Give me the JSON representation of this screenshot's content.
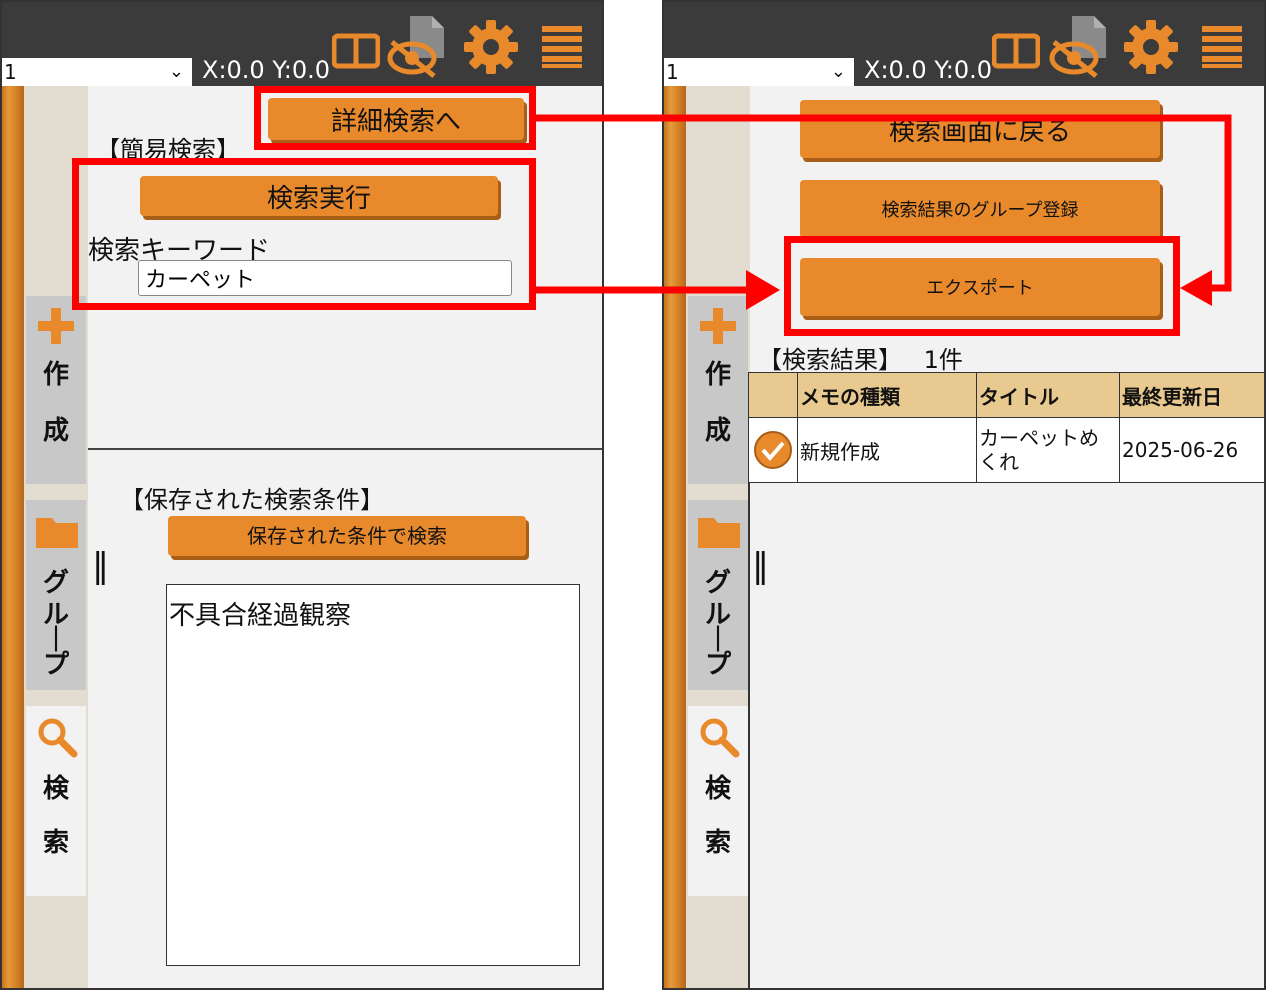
{
  "colors": {
    "accent": "#e8892c",
    "topbar": "#3b3b3b",
    "highlight": "#ff0000",
    "header_row": "#e8c98f"
  },
  "toolbar": {
    "select_value": "1",
    "coords": "X:0.0 Y:0.0",
    "icons": [
      "split-view-icon",
      "hide-icon",
      "gear-icon",
      "menu-icon"
    ]
  },
  "side_tabs": {
    "create": {
      "chars": [
        "作",
        "成"
      ]
    },
    "group": {
      "chars": [
        "グ",
        "ル",
        "|",
        "プ"
      ]
    },
    "search": {
      "chars": [
        "検",
        "索"
      ]
    }
  },
  "left": {
    "advanced_search_button": "詳細検索へ",
    "simple_search_heading": "【簡易検索】",
    "execute_button": "検索実行",
    "keyword_label": "検索キーワード",
    "keyword_value": "カーペット",
    "saved_heading": "【保存された検索条件】",
    "saved_search_button": "保存された条件で検索",
    "saved_conditions": [
      "不具合経過観察"
    ],
    "splitter": "‖"
  },
  "right": {
    "back_button": "検索画面に戻る",
    "group_register_button": "検索結果のグループ登録",
    "export_button": "エクスポート",
    "result_heading": "【検索結果】",
    "result_count": "1件",
    "splitter": "‖",
    "table": {
      "headers": [
        "",
        "メモの種類",
        "タイトル",
        "最終更新日"
      ],
      "rows": [
        {
          "checked": true,
          "type": "新規作成",
          "title": "カーペットめくれ",
          "updated": "2025-06-26"
        }
      ]
    }
  }
}
